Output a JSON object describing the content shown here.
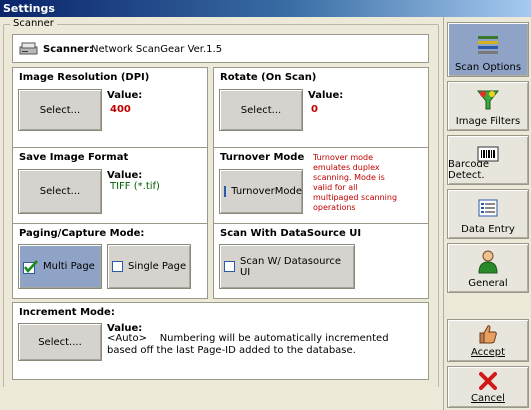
{
  "window": {
    "title": "Settings"
  },
  "group": {
    "title": "Scanner"
  },
  "scanner": {
    "label": "Scanner:",
    "name": "Network ScanGear Ver.1.5"
  },
  "resolution": {
    "title": "Image Resolution (DPI)",
    "button": "Select...",
    "value_label": "Value:",
    "value": "400"
  },
  "rotate": {
    "title": "Rotate (On Scan)",
    "button": "Select...",
    "value_label": "Value:",
    "value": "0"
  },
  "format": {
    "title": "Save Image Format",
    "button": "Select...",
    "value_label": "Value:",
    "value": "TIFF (*.tif)"
  },
  "turnover": {
    "title": "Turnover Mode",
    "button": "TurnoverMode",
    "note_lines": [
      "Turnover mode",
      "emulates duplex",
      "scanning.  Mode is",
      "valid for all",
      "multipaged scanning",
      "operations"
    ]
  },
  "paging": {
    "title": "Paging/Capture Mode:",
    "multi": "Multi Page",
    "single": "Single Page"
  },
  "datasource": {
    "title": "Scan With DataSource UI",
    "button": "Scan W/ Datasource UI"
  },
  "increment": {
    "title": "Increment Mode:",
    "button": "Select....",
    "value_label": "Value:",
    "value_line1": "<Auto>    Numbering will be automatically incremented",
    "value_line2": "based off the last Page-ID added to the database."
  },
  "sidebar": {
    "scan_options": "Scan Options",
    "image_filters": "Image Filters",
    "barcode": "Barcode Detect.",
    "data_entry": "Data Entry",
    "general": "General",
    "accept": "Accept",
    "cancel": "Cancel"
  }
}
